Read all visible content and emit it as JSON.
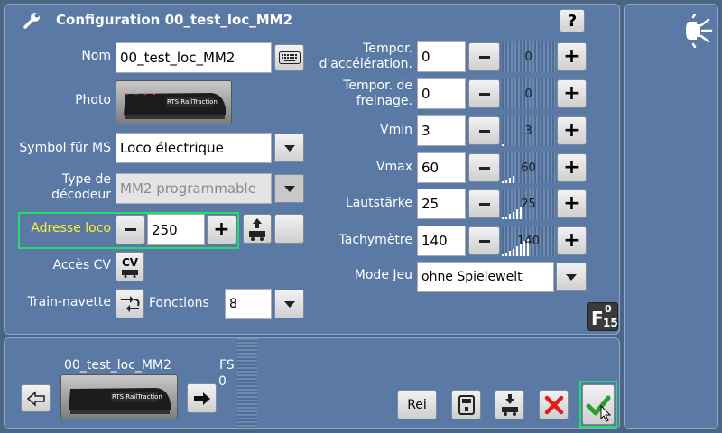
{
  "header": {
    "title": "Configuration 00_test_loc_MM2"
  },
  "form": {
    "nom_label": "Nom",
    "nom_value": "00_test_loc_MM2",
    "photo_label": "Photo",
    "photo_brand": "RTS RailTraction",
    "symbol_label": "Symbol für MS",
    "symbol_value": "Loco électrique",
    "decoder_label": "Type de décodeur",
    "decoder_value": "MM2 programmable",
    "adresse_label": "Adresse loco",
    "adresse_value": "250",
    "cv_label": "Accès CV",
    "cv_button": "CV",
    "navette_label": "Train-navette",
    "fonctions_label": "Fonctions",
    "fonctions_value": "8"
  },
  "params": [
    {
      "label": "Tempor. d'accélération.",
      "value": "0",
      "slider": "0",
      "level": 0
    },
    {
      "label": "Tempor. de freinage.",
      "value": "0",
      "slider": "0",
      "level": 0
    },
    {
      "label": "Vmin",
      "value": "3",
      "slider": "3",
      "level": 0.03
    },
    {
      "label": "Vmax",
      "value": "60",
      "slider": "60",
      "level": 0.24
    },
    {
      "label": "Lautstärke",
      "value": "25",
      "slider": "25",
      "level": 0.4
    },
    {
      "label": "Tachymètre",
      "value": "140",
      "slider": "140",
      "level": 0.55
    }
  ],
  "mode": {
    "label": "Mode Jeu",
    "value": "ohne Spielewelt"
  },
  "functions_badge": {
    "letter": "F",
    "top": "0",
    "bottom": "15"
  },
  "bottom": {
    "loco_name": "00_test_loc_MM2",
    "fs_label": "FS",
    "fs_value": "0",
    "rei_label": "Rei"
  },
  "colors": {
    "highlight": "#22dd66",
    "address_label": "#ffee33",
    "cancel": "#e02020",
    "confirm": "#2a9d2a"
  }
}
